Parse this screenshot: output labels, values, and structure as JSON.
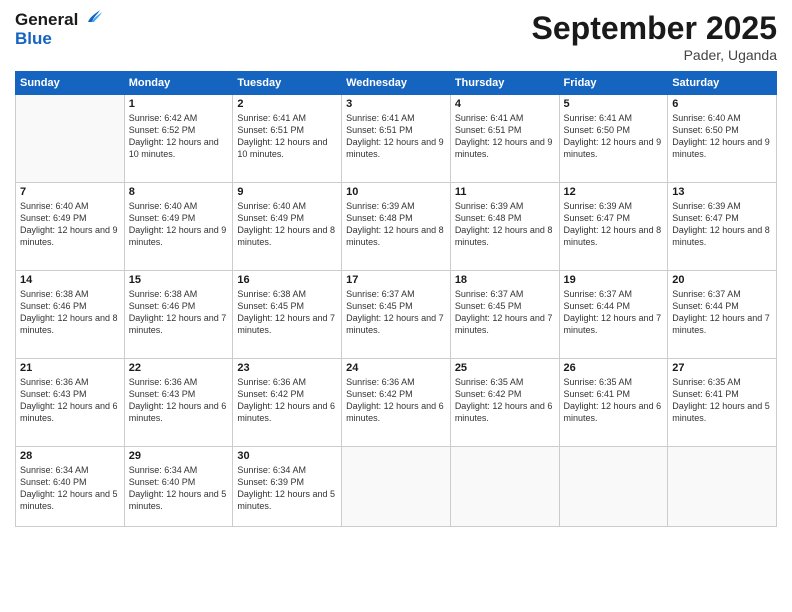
{
  "header": {
    "logo_general": "General",
    "logo_blue": "Blue",
    "month_title": "September 2025",
    "location": "Pader, Uganda"
  },
  "days_of_week": [
    "Sunday",
    "Monday",
    "Tuesday",
    "Wednesday",
    "Thursday",
    "Friday",
    "Saturday"
  ],
  "weeks": [
    [
      {
        "day": "",
        "info": ""
      },
      {
        "day": "1",
        "info": "Sunrise: 6:42 AM\nSunset: 6:52 PM\nDaylight: 12 hours\nand 10 minutes."
      },
      {
        "day": "2",
        "info": "Sunrise: 6:41 AM\nSunset: 6:51 PM\nDaylight: 12 hours\nand 10 minutes."
      },
      {
        "day": "3",
        "info": "Sunrise: 6:41 AM\nSunset: 6:51 PM\nDaylight: 12 hours\nand 9 minutes."
      },
      {
        "day": "4",
        "info": "Sunrise: 6:41 AM\nSunset: 6:51 PM\nDaylight: 12 hours\nand 9 minutes."
      },
      {
        "day": "5",
        "info": "Sunrise: 6:41 AM\nSunset: 6:50 PM\nDaylight: 12 hours\nand 9 minutes."
      },
      {
        "day": "6",
        "info": "Sunrise: 6:40 AM\nSunset: 6:50 PM\nDaylight: 12 hours\nand 9 minutes."
      }
    ],
    [
      {
        "day": "7",
        "info": "Sunrise: 6:40 AM\nSunset: 6:49 PM\nDaylight: 12 hours\nand 9 minutes."
      },
      {
        "day": "8",
        "info": "Sunrise: 6:40 AM\nSunset: 6:49 PM\nDaylight: 12 hours\nand 9 minutes."
      },
      {
        "day": "9",
        "info": "Sunrise: 6:40 AM\nSunset: 6:49 PM\nDaylight: 12 hours\nand 8 minutes."
      },
      {
        "day": "10",
        "info": "Sunrise: 6:39 AM\nSunset: 6:48 PM\nDaylight: 12 hours\nand 8 minutes."
      },
      {
        "day": "11",
        "info": "Sunrise: 6:39 AM\nSunset: 6:48 PM\nDaylight: 12 hours\nand 8 minutes."
      },
      {
        "day": "12",
        "info": "Sunrise: 6:39 AM\nSunset: 6:47 PM\nDaylight: 12 hours\nand 8 minutes."
      },
      {
        "day": "13",
        "info": "Sunrise: 6:39 AM\nSunset: 6:47 PM\nDaylight: 12 hours\nand 8 minutes."
      }
    ],
    [
      {
        "day": "14",
        "info": "Sunrise: 6:38 AM\nSunset: 6:46 PM\nDaylight: 12 hours\nand 8 minutes."
      },
      {
        "day": "15",
        "info": "Sunrise: 6:38 AM\nSunset: 6:46 PM\nDaylight: 12 hours\nand 7 minutes."
      },
      {
        "day": "16",
        "info": "Sunrise: 6:38 AM\nSunset: 6:45 PM\nDaylight: 12 hours\nand 7 minutes."
      },
      {
        "day": "17",
        "info": "Sunrise: 6:37 AM\nSunset: 6:45 PM\nDaylight: 12 hours\nand 7 minutes."
      },
      {
        "day": "18",
        "info": "Sunrise: 6:37 AM\nSunset: 6:45 PM\nDaylight: 12 hours\nand 7 minutes."
      },
      {
        "day": "19",
        "info": "Sunrise: 6:37 AM\nSunset: 6:44 PM\nDaylight: 12 hours\nand 7 minutes."
      },
      {
        "day": "20",
        "info": "Sunrise: 6:37 AM\nSunset: 6:44 PM\nDaylight: 12 hours\nand 7 minutes."
      }
    ],
    [
      {
        "day": "21",
        "info": "Sunrise: 6:36 AM\nSunset: 6:43 PM\nDaylight: 12 hours\nand 6 minutes."
      },
      {
        "day": "22",
        "info": "Sunrise: 6:36 AM\nSunset: 6:43 PM\nDaylight: 12 hours\nand 6 minutes."
      },
      {
        "day": "23",
        "info": "Sunrise: 6:36 AM\nSunset: 6:42 PM\nDaylight: 12 hours\nand 6 minutes."
      },
      {
        "day": "24",
        "info": "Sunrise: 6:36 AM\nSunset: 6:42 PM\nDaylight: 12 hours\nand 6 minutes."
      },
      {
        "day": "25",
        "info": "Sunrise: 6:35 AM\nSunset: 6:42 PM\nDaylight: 12 hours\nand 6 minutes."
      },
      {
        "day": "26",
        "info": "Sunrise: 6:35 AM\nSunset: 6:41 PM\nDaylight: 12 hours\nand 6 minutes."
      },
      {
        "day": "27",
        "info": "Sunrise: 6:35 AM\nSunset: 6:41 PM\nDaylight: 12 hours\nand 5 minutes."
      }
    ],
    [
      {
        "day": "28",
        "info": "Sunrise: 6:34 AM\nSunset: 6:40 PM\nDaylight: 12 hours\nand 5 minutes."
      },
      {
        "day": "29",
        "info": "Sunrise: 6:34 AM\nSunset: 6:40 PM\nDaylight: 12 hours\nand 5 minutes."
      },
      {
        "day": "30",
        "info": "Sunrise: 6:34 AM\nSunset: 6:39 PM\nDaylight: 12 hours\nand 5 minutes."
      },
      {
        "day": "",
        "info": ""
      },
      {
        "day": "",
        "info": ""
      },
      {
        "day": "",
        "info": ""
      },
      {
        "day": "",
        "info": ""
      }
    ]
  ]
}
